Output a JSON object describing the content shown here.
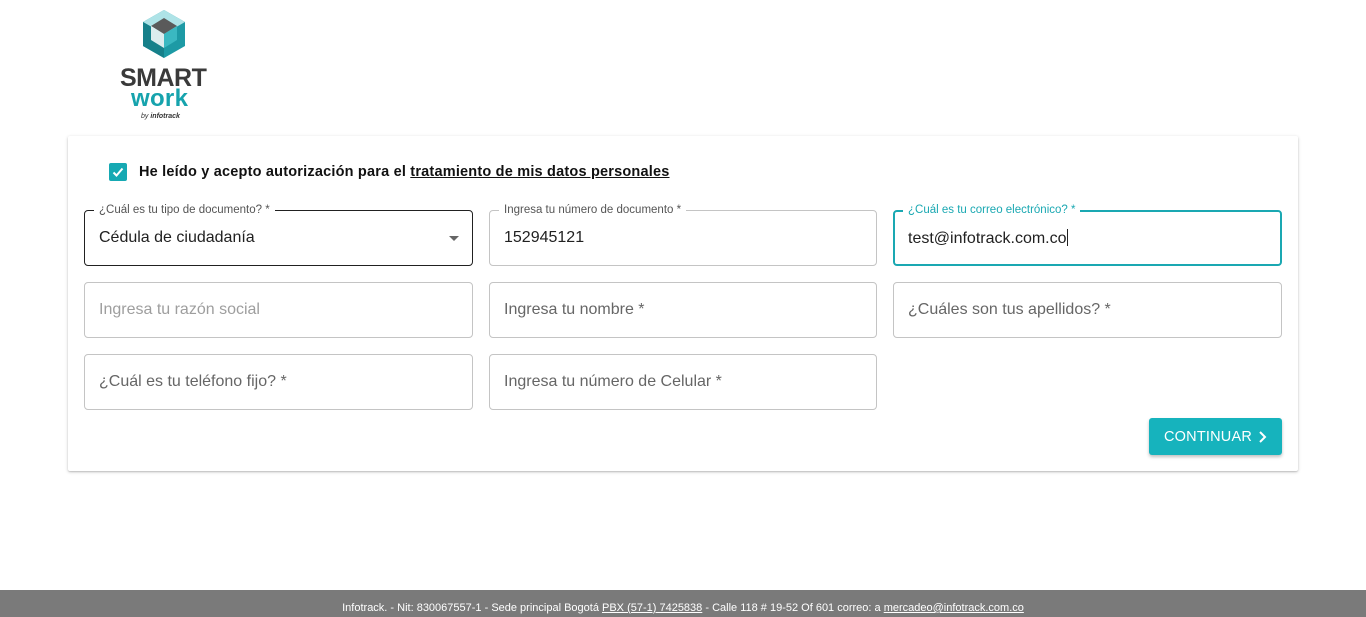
{
  "logo": {
    "top": "SMART",
    "bottom": "work",
    "by": "by",
    "byline": "infotrack"
  },
  "consent": {
    "checked": true,
    "text": "He leído y acepto autorización para el ",
    "link": "tratamiento de mis datos personales"
  },
  "form": {
    "doc_type": {
      "label": "¿Cuál es tu tipo de documento? *",
      "value": "Cédula de ciudadanía"
    },
    "doc_number": {
      "label": "Ingresa tu número de documento *",
      "value": "152945121"
    },
    "email": {
      "label": "¿Cuál es tu correo electrónico? *",
      "value": "test@infotrack.com.co"
    },
    "razon_social": {
      "placeholder": "Ingresa tu razón social"
    },
    "nombre": {
      "placeholder": "Ingresa tu nombre *"
    },
    "apellidos": {
      "placeholder": "¿Cuáles son tus apellidos? *"
    },
    "telefono": {
      "placeholder": "¿Cuál es tu teléfono fijo? *"
    },
    "celular": {
      "placeholder": "Ingresa tu número de Celular *"
    },
    "continue_label": "CONTINUAR"
  },
  "footer": {
    "part1": "Infotrack. - Nit: 830067557-1 - Sede principal Bogotá  ",
    "pbx": "PBX (57-1) 7425838",
    "part2": " - Calle 118 # 19-52 Of 601    correo: a ",
    "email": "mercadeo@infotrack.com.co"
  },
  "colors": {
    "accent": "#16b3bd",
    "footer_bg": "#7a7a7a",
    "logo_teal": "#16a3ad"
  }
}
